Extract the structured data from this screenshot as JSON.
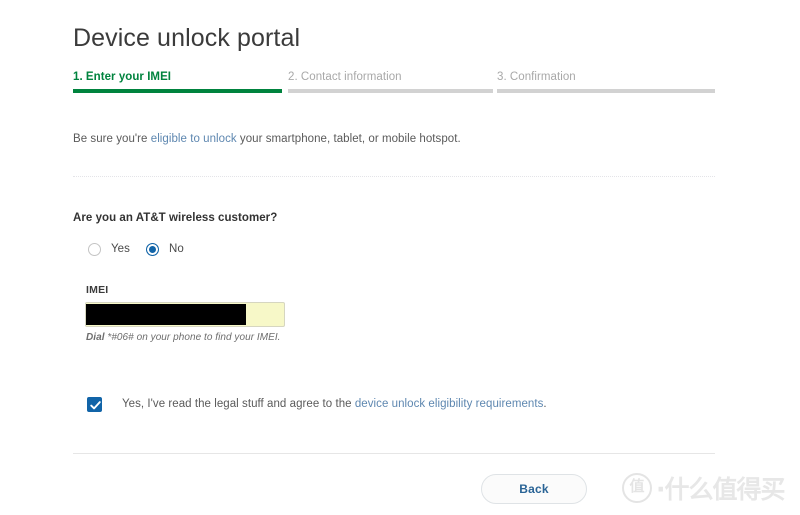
{
  "page": {
    "title": "Device unlock portal",
    "background_color": "#ffffff"
  },
  "colors": {
    "accent_green": "#00833e",
    "inactive_gray": "#d2d2d2",
    "link_blue": "#5e87b0",
    "control_blue": "#1164a8",
    "button_text_blue": "#2a6496",
    "autofill_yellow": "#f7f8c8"
  },
  "stepper": {
    "steps": [
      {
        "label": "1. Enter your IMEI",
        "state": "active"
      },
      {
        "label": "2. Contact information",
        "state": "inactive"
      },
      {
        "label": "3. Confirmation",
        "state": "inactive"
      }
    ]
  },
  "intro": {
    "text_before": "Be sure you're ",
    "link_text": "eligible to unlock",
    "text_after": " your smartphone, tablet, or mobile hotspot."
  },
  "question": {
    "label": "Are you an AT&T wireless customer?",
    "options": [
      {
        "label": "Yes",
        "selected": false
      },
      {
        "label": "No",
        "selected": true
      }
    ]
  },
  "imei": {
    "label": "IMEI",
    "value": "",
    "placeholder": "",
    "redacted": true,
    "hint_bold": "Dial",
    "hint_rest": " *#06# on your phone to find your IMEI."
  },
  "consent": {
    "checked": true,
    "text_before": "Yes, I've read the legal stuff and agree to the ",
    "link_text": "device unlock eligibility requirements",
    "text_after": "."
  },
  "footer": {
    "back_label": "Back"
  },
  "watermark": {
    "badge": "值",
    "text": "·什么值得买"
  }
}
